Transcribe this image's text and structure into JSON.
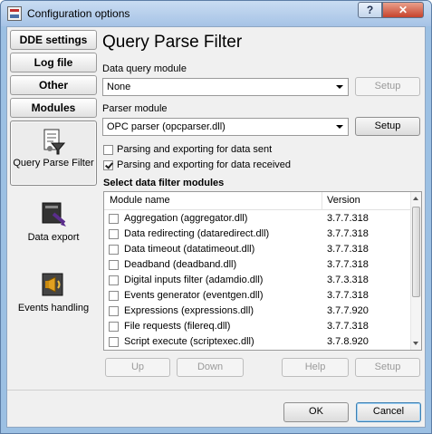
{
  "window": {
    "title": "Configuration options",
    "help_glyph": "?",
    "close_glyph": "✕"
  },
  "nav": {
    "buttons": [
      "DDE settings",
      "Log file",
      "Other",
      "Modules"
    ],
    "items": [
      {
        "label": "Query Parse Filter",
        "icon": "query-parse-filter-icon",
        "selected": true
      },
      {
        "label": "Data export",
        "icon": "data-export-icon",
        "selected": false
      },
      {
        "label": "Events handling",
        "icon": "events-handling-icon",
        "selected": false
      }
    ]
  },
  "main": {
    "heading": "Query Parse Filter",
    "data_query_label": "Data query module",
    "data_query_value": "None",
    "data_query_setup": "Setup",
    "parser_label": "Parser module",
    "parser_value": "OPC parser (opcparser.dll)",
    "parser_setup": "Setup",
    "check_sent": {
      "label": "Parsing and exporting for data sent",
      "checked": false
    },
    "check_received": {
      "label": "Parsing and exporting for data received",
      "checked": true
    },
    "section_title": "Select data filter modules",
    "columns": [
      "Module name",
      "Version"
    ],
    "modules": [
      {
        "name": "Aggregation (aggregator.dll)",
        "version": "3.7.7.318"
      },
      {
        "name": "Data redirecting (dataredirect.dll)",
        "version": "3.7.7.318"
      },
      {
        "name": "Data timeout (datatimeout.dll)",
        "version": "3.7.7.318"
      },
      {
        "name": "Deadband (deadband.dll)",
        "version": "3.7.7.318"
      },
      {
        "name": "Digital inputs filter (adamdio.dll)",
        "version": "3.7.3.318"
      },
      {
        "name": "Events generator (eventgen.dll)",
        "version": "3.7.7.318"
      },
      {
        "name": "Expressions (expressions.dll)",
        "version": "3.7.7.920"
      },
      {
        "name": "File requests (filereq.dll)",
        "version": "3.7.7.318"
      },
      {
        "name": "Script execute (scriptexec.dll)",
        "version": "3.7.8.920"
      }
    ],
    "list_buttons": [
      "Up",
      "Down",
      "Help",
      "Setup"
    ]
  },
  "footer": {
    "ok": "OK",
    "cancel": "Cancel"
  },
  "colors": {
    "title_bar": "#a6c3e6",
    "close_button": "#c7432c",
    "dialog_bg": "#f0f0f0"
  }
}
